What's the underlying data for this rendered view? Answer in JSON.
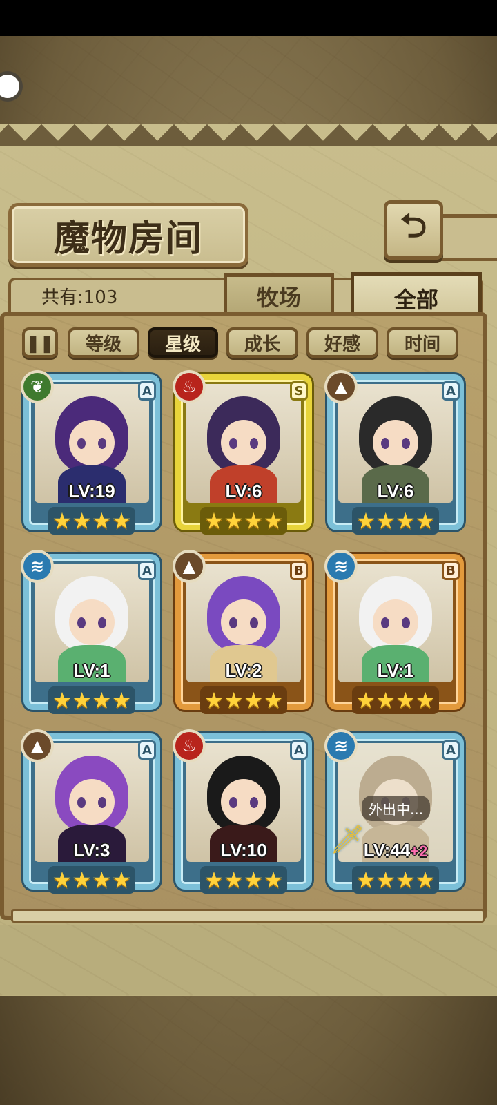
{
  "header": {
    "title": "魔物房间",
    "back_icon": "return-arrow-icon"
  },
  "summary": {
    "count_label": "共有:103"
  },
  "tabs": [
    {
      "label": "牧场",
      "active": false
    },
    {
      "label": "全部",
      "active": true
    }
  ],
  "sort": {
    "toggle_icon": "pause-sort-icon",
    "options": [
      {
        "label": "等级",
        "active": false
      },
      {
        "label": "星级",
        "active": true
      },
      {
        "label": "成长",
        "active": false
      },
      {
        "label": "好感",
        "active": false
      },
      {
        "label": "时间",
        "active": false
      }
    ]
  },
  "monsters": [
    {
      "element": "wood",
      "element_icon": "leaf-icon",
      "rank": "A",
      "level": "LV:19",
      "plus": "",
      "stars": 4,
      "status": "",
      "hair": "#4b2a7a",
      "body": "#2b2d6e"
    },
    {
      "element": "fire",
      "element_icon": "flame-icon",
      "rank": "S",
      "level": "LV:6",
      "plus": "",
      "stars": 4,
      "status": "",
      "hair": "#3c2a5a",
      "body": "#c0402a"
    },
    {
      "element": "earth",
      "element_icon": "mountain-icon",
      "rank": "A",
      "level": "LV:6",
      "plus": "",
      "stars": 4,
      "status": "",
      "hair": "#2a2a2a",
      "body": "#5a6a4a"
    },
    {
      "element": "water",
      "element_icon": "wave-icon",
      "rank": "A",
      "level": "LV:1",
      "plus": "",
      "stars": 4,
      "status": "",
      "hair": "#f2f2f2",
      "body": "#5ab070"
    },
    {
      "element": "earth",
      "element_icon": "mountain-icon",
      "rank": "B",
      "level": "LV:2",
      "plus": "",
      "stars": 4,
      "status": "",
      "hair": "#7a4ac0",
      "body": "#e0c890"
    },
    {
      "element": "water",
      "element_icon": "wave-icon",
      "rank": "B",
      "level": "LV:1",
      "plus": "",
      "stars": 4,
      "status": "",
      "hair": "#f2f2f2",
      "body": "#5ab070"
    },
    {
      "element": "earth",
      "element_icon": "mountain-icon",
      "rank": "A",
      "level": "LV:3",
      "plus": "",
      "stars": 4,
      "status": "",
      "hair": "#8a4ac0",
      "body": "#2a1a3a"
    },
    {
      "element": "fire",
      "element_icon": "flame-icon",
      "rank": "A",
      "level": "LV:10",
      "plus": "",
      "stars": 4,
      "status": "",
      "hair": "#1a1a1a",
      "body": "#3a1a1a"
    },
    {
      "element": "water",
      "element_icon": "wave-icon",
      "rank": "A",
      "level": "LV:44",
      "plus": "+2",
      "stars": 4,
      "status": "外出中...",
      "hair": "#8a6a40",
      "body": "#a08050"
    }
  ]
}
